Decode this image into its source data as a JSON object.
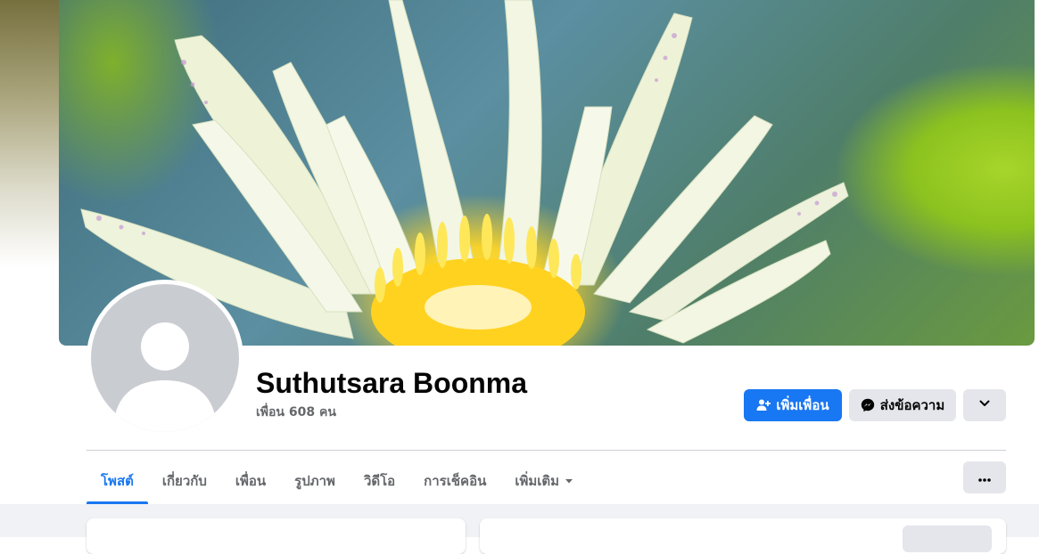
{
  "profile": {
    "name": "Suthutsara Boonma",
    "friend_count": "เพื่อน 608 คน"
  },
  "actions": {
    "add_friend": "เพิ่มเพื่อน",
    "message": "ส่งข้อความ"
  },
  "tabs": [
    {
      "label": "โพสต์",
      "active": true
    },
    {
      "label": "เกี่ยวกับ",
      "active": false
    },
    {
      "label": "เพื่อน",
      "active": false
    },
    {
      "label": "รูปภาพ",
      "active": false
    },
    {
      "label": "วิดีโอ",
      "active": false
    },
    {
      "label": "การเช็คอิน",
      "active": false
    },
    {
      "label": "เพิ่มเติม",
      "active": false
    }
  ],
  "sections": {
    "left_title": "",
    "right_title": "",
    "right_button": ""
  },
  "icons": {
    "add_friend": "person-plus-icon",
    "message": "messenger-icon",
    "more_actions": "chevron-down-icon",
    "tab_more": "caret-down-icon",
    "tabs_menu": "ellipsis-icon"
  },
  "colors": {
    "accent": "#1877f2",
    "secondary_button": "#e4e6eb",
    "muted_text": "#65676b",
    "feed_background": "#f0f2f5"
  }
}
